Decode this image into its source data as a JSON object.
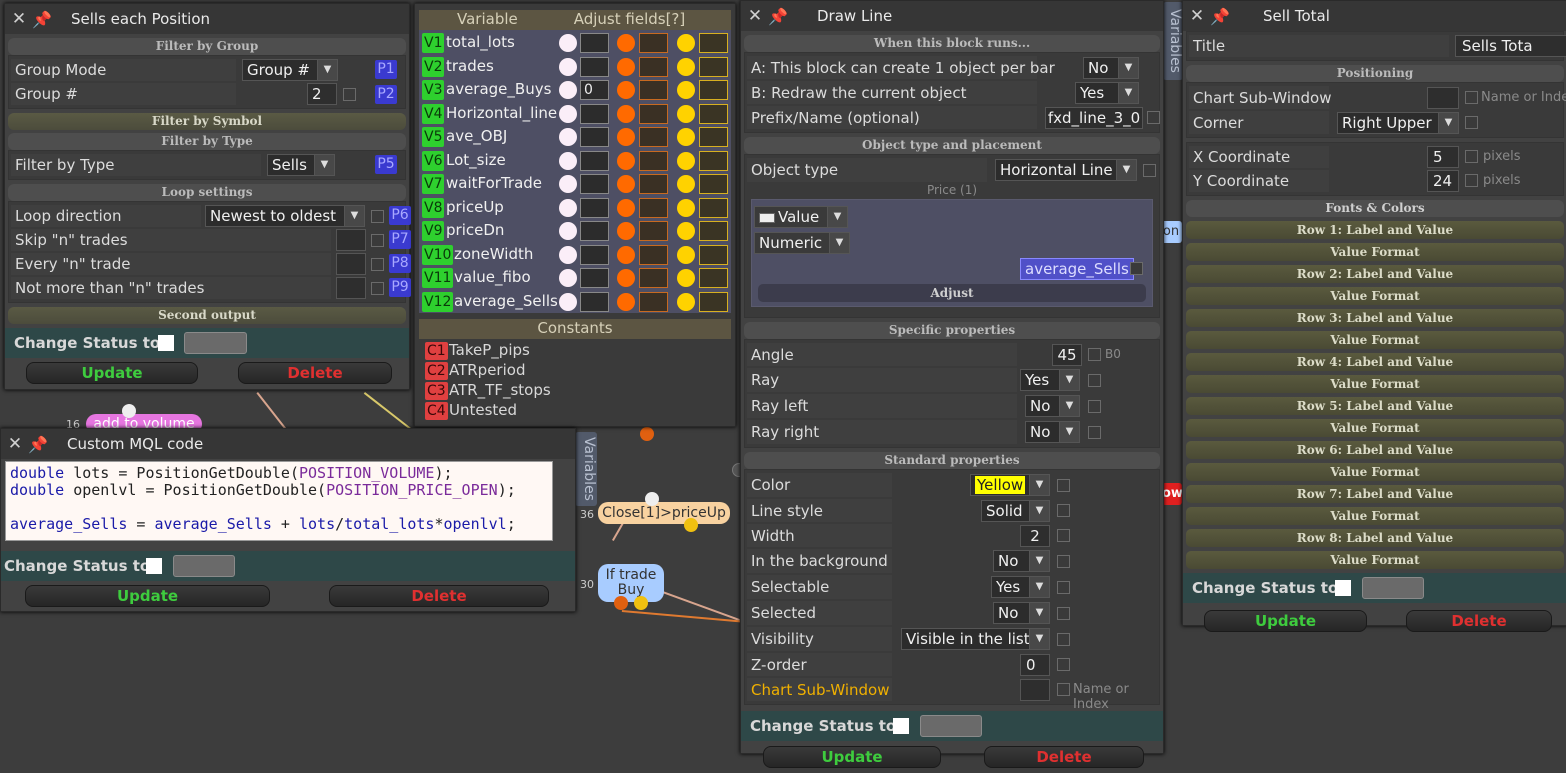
{
  "colors": {
    "accent_green": "#3ecc3e",
    "delete_red": "#e03030",
    "param_blue": "#3a3ad0",
    "var_green": "#2ed02e",
    "const_red": "#e04040",
    "yellow": "#ffff00"
  },
  "canvas": {
    "node_add_volume": {
      "num": "16",
      "label": "add to volume"
    },
    "node_close": {
      "num": "36",
      "label": "Close[1]>priceUp"
    },
    "node_if": {
      "num": "30",
      "label_line1": "If trade",
      "label_line2": "Buy"
    },
    "node_right_partial": "on",
    "node_red_partial": "ow",
    "variables_tab_mid": "Variables",
    "variables_tab_right": "Variables"
  },
  "sells": {
    "title": "Sells each Position",
    "filter_group": "Filter by Group",
    "group_mode_label": "Group Mode",
    "group_mode_value": "Group #",
    "group_num_label": "Group #",
    "group_num_value": "2",
    "p1": "P1",
    "p2": "P2",
    "filter_symbol": "Filter by Symbol",
    "filter_type_section": "Filter by Type",
    "filter_type_label": "Filter by Type",
    "filter_type_value": "Sells",
    "p5": "P5",
    "loop_settings": "Loop settings",
    "loop_dir_label": "Loop direction",
    "loop_dir_value": "Newest to oldest",
    "skip_label": "Skip \"n\" trades",
    "every_label": "Every \"n\" trade",
    "notmore_label": "Not more than \"n\" trades",
    "p6": "P6",
    "p7": "P7",
    "p8": "P8",
    "p9": "P9",
    "second_output": "Second output",
    "change_status": "Change Status to",
    "update": "Update",
    "delete": "Delete"
  },
  "vars": {
    "header_variable": "Variable",
    "header_adjust": "Adjust fields[?]",
    "rows": [
      {
        "id": "V1",
        "name": "total_lots",
        "val": ""
      },
      {
        "id": "V2",
        "name": "trades",
        "val": ""
      },
      {
        "id": "V3",
        "name": "average_Buys",
        "val": "0"
      },
      {
        "id": "V4",
        "name": "Horizontal_line",
        "val": ""
      },
      {
        "id": "V5",
        "name": "ave_OBJ",
        "val": ""
      },
      {
        "id": "V6",
        "name": "Lot_size",
        "val": ""
      },
      {
        "id": "V7",
        "name": "waitForTrade",
        "val": ""
      },
      {
        "id": "V8",
        "name": "priceUp",
        "val": ""
      },
      {
        "id": "V9",
        "name": "priceDn",
        "val": ""
      },
      {
        "id": "V10",
        "name": "zoneWidth",
        "val": ""
      },
      {
        "id": "V11",
        "name": "value_fibo",
        "val": ""
      },
      {
        "id": "V12",
        "name": "average_Sells",
        "val": ""
      }
    ],
    "constants_label": "Constants",
    "constants": [
      {
        "id": "C1",
        "name": "TakeP_pips"
      },
      {
        "id": "C2",
        "name": "ATRperiod"
      },
      {
        "id": "C3",
        "name": "ATR_TF_stops"
      },
      {
        "id": "C4",
        "name": "Untested"
      }
    ]
  },
  "mql": {
    "title": "Custom MQL code",
    "change_status": "Change Status to",
    "update": "Update",
    "delete": "Delete"
  },
  "draw": {
    "title": "Draw Line",
    "when_runs": "When this block runs...",
    "a_label": "A: This block can create 1 object per bar",
    "a_value": "No",
    "b_label": "B: Redraw the current object",
    "b_value": "Yes",
    "prefix_label": "Prefix/Name (optional)",
    "prefix_value": "fxd_line_3_0",
    "obj_section": "Object type and placement",
    "obj_type_label": "Object type",
    "obj_type_value": "Horizontal Line",
    "price_label": "Price (1)",
    "value_dd": "Value",
    "numeric_dd": "Numeric",
    "avg_sells": "average_Sells",
    "adjust": "Adjust",
    "specific": "Specific properties",
    "angle_label": "Angle",
    "angle_value": "45",
    "b0": "B0",
    "ray_label": "Ray",
    "ray_value": "Yes",
    "ray_left_label": "Ray left",
    "ray_left_value": "No",
    "ray_right_label": "Ray right",
    "ray_right_value": "No",
    "standard": "Standard properties",
    "color_label": "Color",
    "color_value": "Yellow",
    "style_label": "Line style",
    "style_value": "Solid",
    "width_label": "Width",
    "width_value": "2",
    "bg_label": "In the background",
    "bg_value": "No",
    "selectable_label": "Selectable",
    "selectable_value": "Yes",
    "selected_label": "Selected",
    "selected_value": "No",
    "visibility_label": "Visibility",
    "visibility_value": "Visible in the list",
    "zorder_label": "Z-order",
    "zorder_value": "0",
    "subwin_label": "Chart Sub-Window",
    "name_or_index": "Name or Index",
    "change_status": "Change Status to",
    "update": "Update",
    "delete": "Delete"
  },
  "total": {
    "title": "Sell Total",
    "title_label": "Title",
    "title_value": "Sells Tota",
    "positioning": "Positioning",
    "subwin_label": "Chart Sub-Window",
    "name_or_index": "Name or Index",
    "corner_label": "Corner",
    "corner_value": "Right Upper",
    "x_label": "X Coordinate",
    "x_value": "5",
    "y_label": "Y Coordinate",
    "y_value": "24",
    "pixels": "pixels",
    "fonts": "Fonts & Colors",
    "rows": [
      "Row 1: Label and Value",
      "Value Format",
      "Row 2: Label and Value",
      "Value Format",
      "Row 3: Label and Value",
      "Value Format",
      "Row 4: Label and Value",
      "Value Format",
      "Row 5: Label and Value",
      "Value Format",
      "Row 6: Label and Value",
      "Value Format",
      "Row 7: Label and Value",
      "Value Format",
      "Row 8: Label and Value",
      "Value Format"
    ],
    "change_status": "Change Status to",
    "update": "Update",
    "delete": "Delete"
  }
}
